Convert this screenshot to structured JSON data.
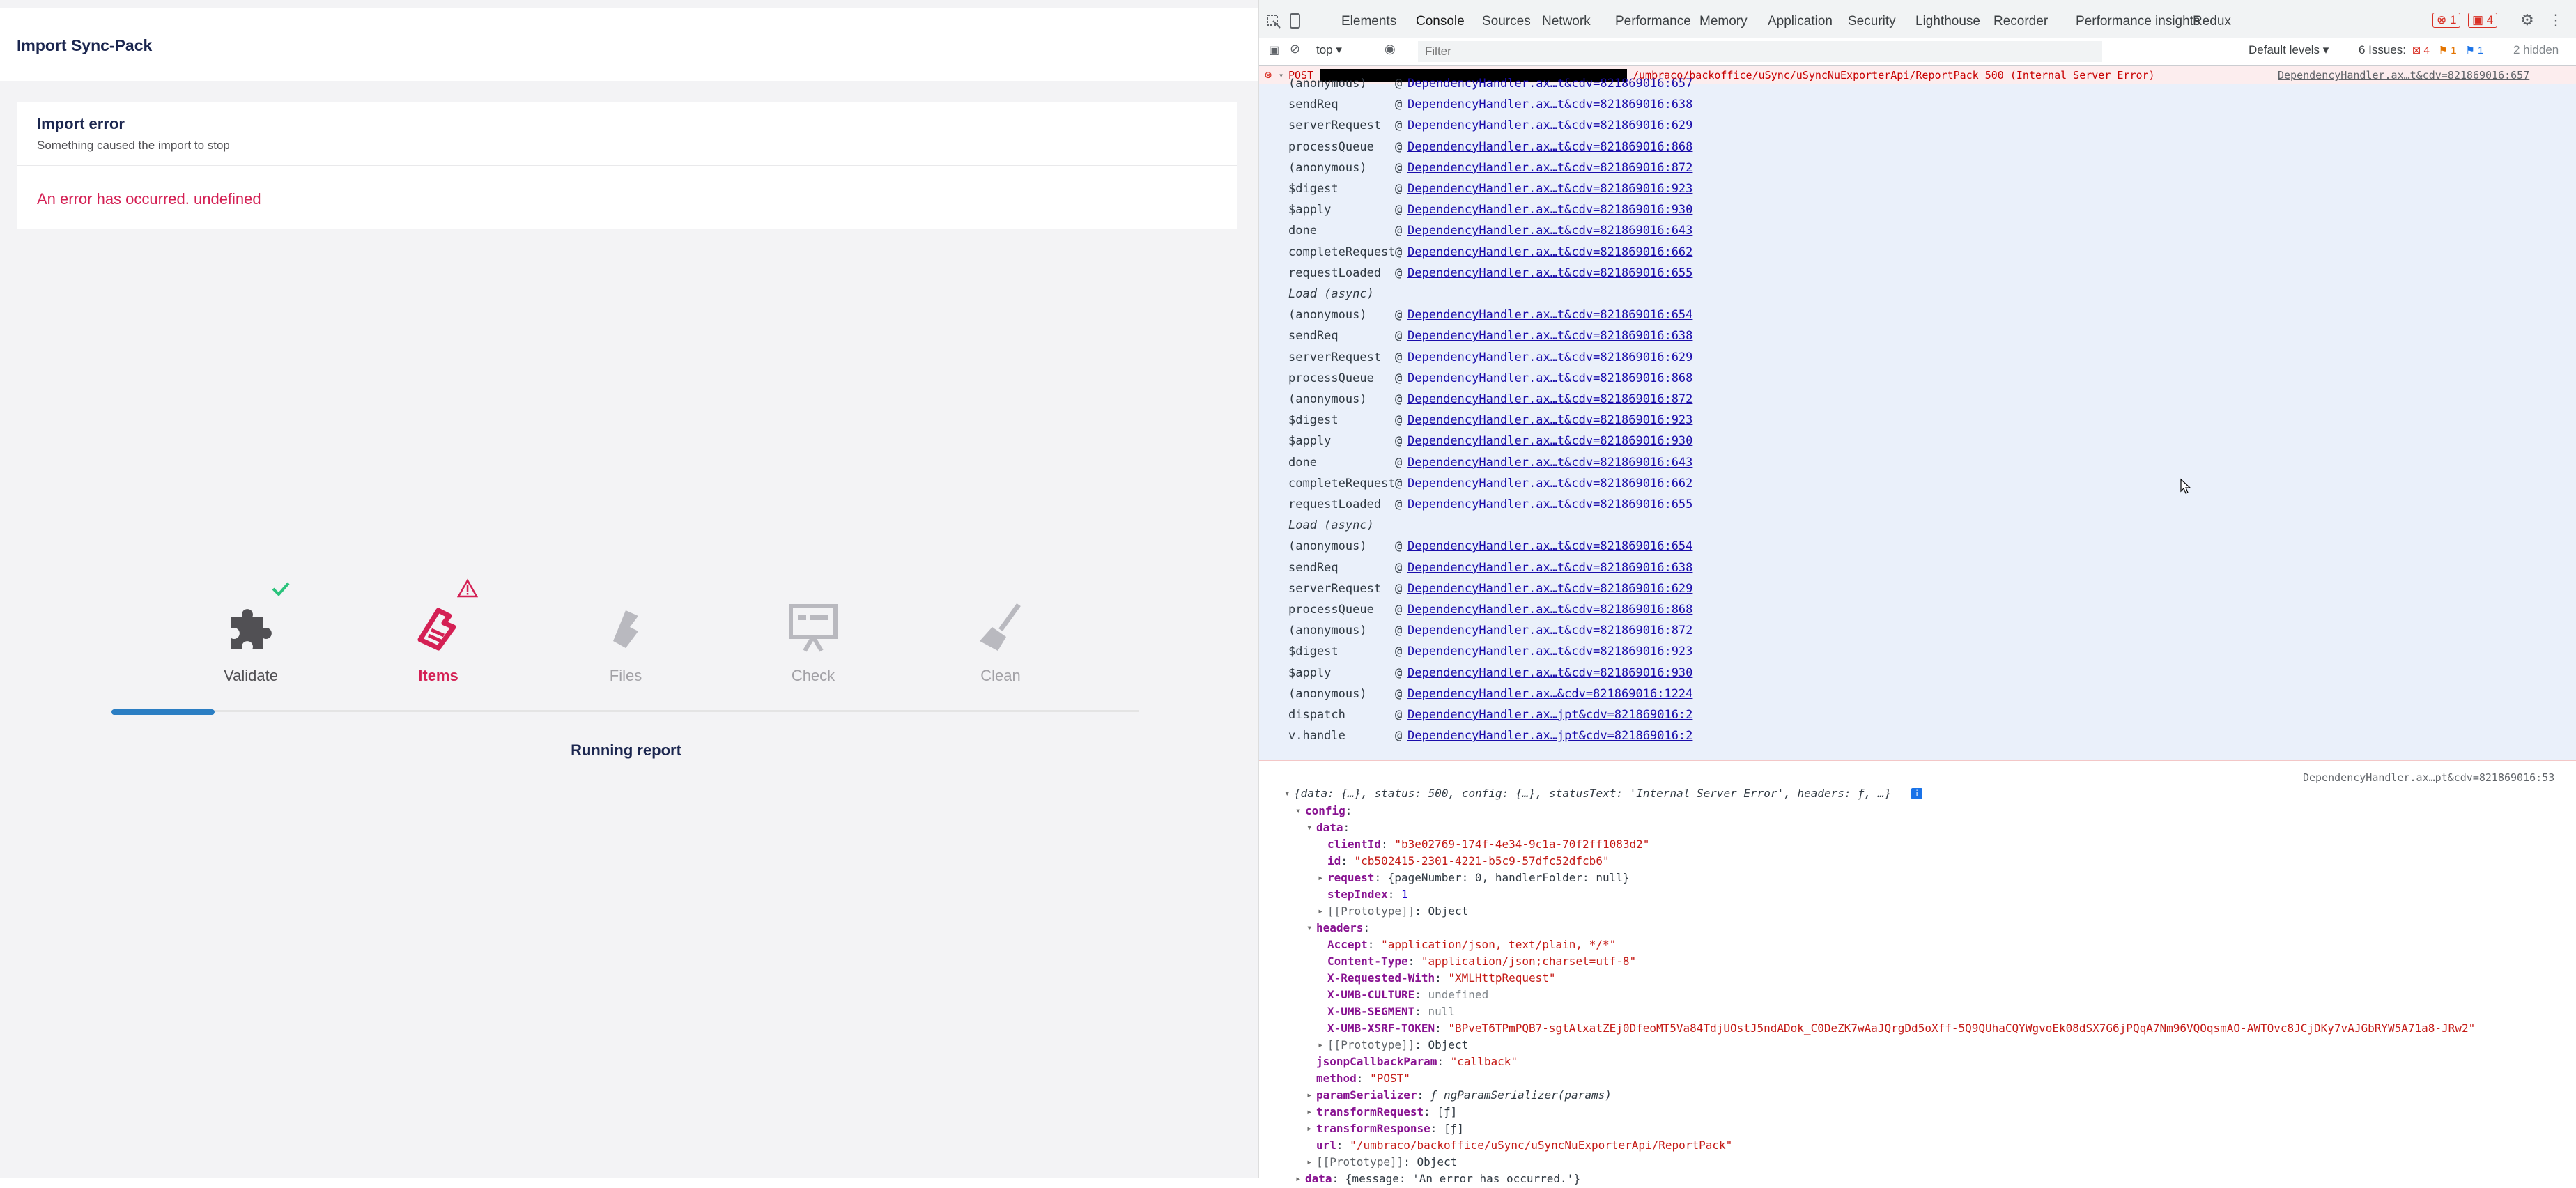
{
  "app": {
    "title": "Import Sync-Pack",
    "error_title": "Import error",
    "error_subtitle": "Something caused the import to stop",
    "error_message": "An error has occurred. undefined",
    "steps": [
      {
        "label": "Validate",
        "icon": "puzzle-icon",
        "state": "done"
      },
      {
        "label": "Items",
        "icon": "items-hand-icon",
        "state": "error"
      },
      {
        "label": "Files",
        "icon": "files-icon",
        "state": "pending"
      },
      {
        "label": "Check",
        "icon": "check-presentation-icon",
        "state": "pending"
      },
      {
        "label": "Clean",
        "icon": "broom-icon",
        "state": "pending"
      }
    ],
    "progress_fraction": 0.1,
    "status": "Running report"
  },
  "devtools": {
    "tabs": [
      "Elements",
      "Console",
      "Sources",
      "Network",
      "Performance",
      "Memory",
      "Application",
      "Security",
      "Lighthouse",
      "Recorder",
      "Performance insights",
      "Redux"
    ],
    "active_tab": "Console",
    "error_badge": "1",
    "warning_badge": "4",
    "context": "top",
    "filter_placeholder": "Filter",
    "levels": "Default levels",
    "issues_label": "6 Issues:",
    "issues_errors": "4",
    "issues_warnings": "1",
    "issues_info": "1",
    "hidden": "2 hidden",
    "request_line": {
      "method": "POST",
      "url": "/umbraco/backoffice/uSync/uSyncNuExporterApi/ReportPack",
      "status": "500 (Internal Server Error)",
      "source": "DependencyHandler.ax…t&cdv=821869016:657"
    },
    "stack": [
      {
        "fn": "(anonymous)",
        "link": "DependencyHandler.ax…t&cdv=821869016:657"
      },
      {
        "fn": "sendReq",
        "link": "DependencyHandler.ax…t&cdv=821869016:638"
      },
      {
        "fn": "serverRequest",
        "link": "DependencyHandler.ax…t&cdv=821869016:629"
      },
      {
        "fn": "processQueue",
        "link": "DependencyHandler.ax…t&cdv=821869016:868"
      },
      {
        "fn": "(anonymous)",
        "link": "DependencyHandler.ax…t&cdv=821869016:872"
      },
      {
        "fn": "$digest",
        "link": "DependencyHandler.ax…t&cdv=821869016:923"
      },
      {
        "fn": "$apply",
        "link": "DependencyHandler.ax…t&cdv=821869016:930"
      },
      {
        "fn": "done",
        "link": "DependencyHandler.ax…t&cdv=821869016:643"
      },
      {
        "fn": "completeRequest",
        "link": "DependencyHandler.ax…t&cdv=821869016:662"
      },
      {
        "fn": "requestLoaded",
        "link": "DependencyHandler.ax…t&cdv=821869016:655"
      },
      {
        "async": "Load (async)"
      },
      {
        "fn": "(anonymous)",
        "link": "DependencyHandler.ax…t&cdv=821869016:654"
      },
      {
        "fn": "sendReq",
        "link": "DependencyHandler.ax…t&cdv=821869016:638"
      },
      {
        "fn": "serverRequest",
        "link": "DependencyHandler.ax…t&cdv=821869016:629"
      },
      {
        "fn": "processQueue",
        "link": "DependencyHandler.ax…t&cdv=821869016:868"
      },
      {
        "fn": "(anonymous)",
        "link": "DependencyHandler.ax…t&cdv=821869016:872"
      },
      {
        "fn": "$digest",
        "link": "DependencyHandler.ax…t&cdv=821869016:923"
      },
      {
        "fn": "$apply",
        "link": "DependencyHandler.ax…t&cdv=821869016:930"
      },
      {
        "fn": "done",
        "link": "DependencyHandler.ax…t&cdv=821869016:643"
      },
      {
        "fn": "completeRequest",
        "link": "DependencyHandler.ax…t&cdv=821869016:662"
      },
      {
        "fn": "requestLoaded",
        "link": "DependencyHandler.ax…t&cdv=821869016:655"
      },
      {
        "async": "Load (async)"
      },
      {
        "fn": "(anonymous)",
        "link": "DependencyHandler.ax…t&cdv=821869016:654"
      },
      {
        "fn": "sendReq",
        "link": "DependencyHandler.ax…t&cdv=821869016:638"
      },
      {
        "fn": "serverRequest",
        "link": "DependencyHandler.ax…t&cdv=821869016:629"
      },
      {
        "fn": "processQueue",
        "link": "DependencyHandler.ax…t&cdv=821869016:868"
      },
      {
        "fn": "(anonymous)",
        "link": "DependencyHandler.ax…t&cdv=821869016:872"
      },
      {
        "fn": "$digest",
        "link": "DependencyHandler.ax…t&cdv=821869016:923"
      },
      {
        "fn": "$apply",
        "link": "DependencyHandler.ax…t&cdv=821869016:930"
      },
      {
        "fn": "(anonymous)",
        "link": "DependencyHandler.ax…&cdv=821869016:1224"
      },
      {
        "fn": "dispatch",
        "link": "DependencyHandler.ax…jpt&cdv=821869016:2"
      },
      {
        "fn": "v.handle",
        "link": "DependencyHandler.ax…jpt&cdv=821869016:2"
      }
    ],
    "log_source": "DependencyHandler.ax…pt&cdv=821869016:53",
    "object_summary": "{data: {…}, status: 500, config: {…}, statusText: 'Internal Server Error', headers: ƒ, …}",
    "object_tree": [
      {
        "indent": 1,
        "arrow": "▾",
        "key": "config",
        "val": ""
      },
      {
        "indent": 2,
        "arrow": "▾",
        "key": "data",
        "val": ""
      },
      {
        "indent": 3,
        "arrow": "",
        "key": "clientId",
        "val": "\"b3e02769-174f-4e34-9c1a-70f2ff1083d2\"",
        "type": "str"
      },
      {
        "indent": 3,
        "arrow": "",
        "key": "id",
        "val": "\"cb502415-2301-4221-b5c9-57dfc52dfcb6\"",
        "type": "str"
      },
      {
        "indent": 3,
        "arrow": "▸",
        "key": "request",
        "val": "{pageNumber: 0, handlerFolder: null}",
        "type": "plain"
      },
      {
        "indent": 3,
        "arrow": "",
        "key": "stepIndex",
        "val": "1",
        "type": "num"
      },
      {
        "indent": 3,
        "arrow": "▸",
        "key": "[[Prototype]]",
        "val": "Object",
        "type": "plain",
        "gray": true
      },
      {
        "indent": 2,
        "arrow": "▾",
        "key": "headers",
        "val": ""
      },
      {
        "indent": 3,
        "arrow": "",
        "key": "Accept",
        "val": "\"application/json, text/plain, */*\"",
        "type": "str"
      },
      {
        "indent": 3,
        "arrow": "",
        "key": "Content-Type",
        "val": "\"application/json;charset=utf-8\"",
        "type": "str"
      },
      {
        "indent": 3,
        "arrow": "",
        "key": "X-Requested-With",
        "val": "\"XMLHttpRequest\"",
        "type": "str"
      },
      {
        "indent": 3,
        "arrow": "",
        "key": "X-UMB-CULTURE",
        "val": "undefined",
        "type": "gray"
      },
      {
        "indent": 3,
        "arrow": "",
        "key": "X-UMB-SEGMENT",
        "val": "null",
        "type": "gray"
      },
      {
        "indent": 3,
        "arrow": "",
        "key": "X-UMB-XSRF-TOKEN",
        "val": "\"BPveT6TPmPQB7-sgtAlxatZEj0DfeoMT5Va84TdjUOstJ5ndADok_C0DeZK7wAaJQrgDd5oXff-5Q9QUhaCQYWgvoEk08dSX7G6jPQqA7Nm96VQOqsmAO-AWTOvc8JCjDKy7vAJGbRYW5A71a8-JRw2\"",
        "type": "str"
      },
      {
        "indent": 3,
        "arrow": "▸",
        "key": "[[Prototype]]",
        "val": "Object",
        "type": "plain",
        "gray": true
      },
      {
        "indent": 2,
        "arrow": "",
        "key": "jsonpCallbackParam",
        "val": "\"callback\"",
        "type": "str"
      },
      {
        "indent": 2,
        "arrow": "",
        "key": "method",
        "val": "\"POST\"",
        "type": "str"
      },
      {
        "indent": 2,
        "arrow": "▸",
        "key": "paramSerializer",
        "val": "ƒ ngParamSerializer(params)",
        "type": "italic"
      },
      {
        "indent": 2,
        "arrow": "▸",
        "key": "transformRequest",
        "val": "[ƒ]",
        "type": "plain"
      },
      {
        "indent": 2,
        "arrow": "▸",
        "key": "transformResponse",
        "val": "[ƒ]",
        "type": "plain"
      },
      {
        "indent": 2,
        "arrow": "",
        "key": "url",
        "val": "\"/umbraco/backoffice/uSync/uSyncNuExporterApi/ReportPack\"",
        "type": "str"
      },
      {
        "indent": 2,
        "arrow": "▸",
        "key": "[[Prototype]]",
        "val": "Object",
        "type": "plain",
        "gray": true
      },
      {
        "indent": 1,
        "arrow": "▸",
        "key": "data",
        "val": "{message: 'An error has occurred.'}",
        "type": "plain"
      }
    ]
  }
}
